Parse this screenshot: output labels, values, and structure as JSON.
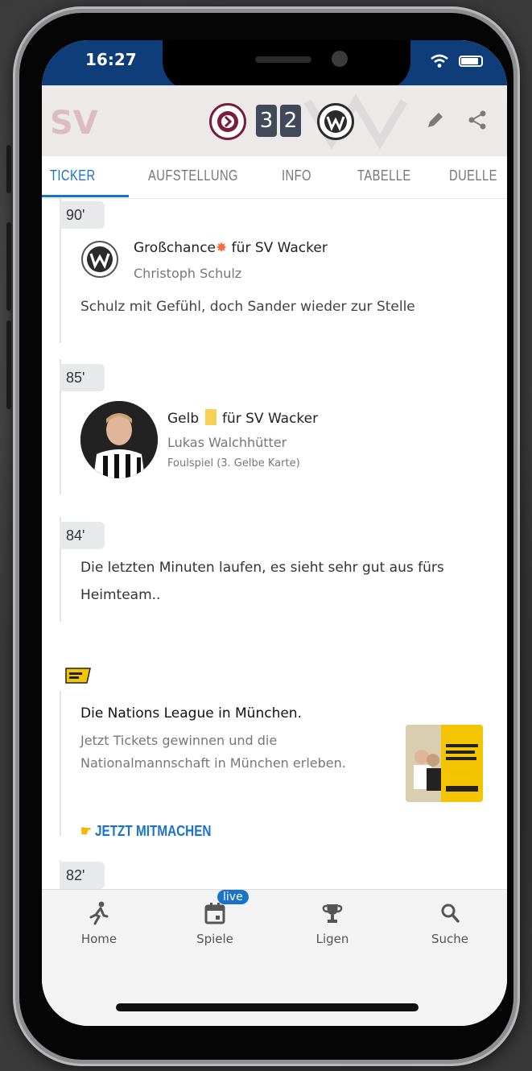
{
  "status": {
    "time": "16:27"
  },
  "match": {
    "home_score": "3",
    "away_score": "2"
  },
  "tabs": [
    "TICKER",
    "AUFSTELLUNG",
    "INFO",
    "TABELLE",
    "DUELLE"
  ],
  "ticker": [
    {
      "minute": "90'",
      "title_prefix": "Großchance",
      "title_suffix": " für SV Wacker",
      "player": "Christoph Schulz",
      "text": "Schulz mit Gefühl, doch Sander wieder zur Stelle"
    },
    {
      "minute": "85'",
      "title_prefix": "Gelb ",
      "title_suffix": " für SV Wacker",
      "player": "Lukas Walchhütter",
      "detail": "Foulspiel (3. Gelbe Karte)"
    },
    {
      "minute": "84'",
      "text_line1": "Die letzten Minuten laufen, es sieht sehr gut aus fürs",
      "text_line2": "Heimteam.."
    }
  ],
  "ad": {
    "title": "Die Nations League in München.",
    "line1": "Jetzt Tickets gewinnen und die",
    "line2": "Nationalmannschaft in München erleben.",
    "cta": "JETZT MITMACHEN"
  },
  "next_minute": "82'",
  "nav": {
    "home": "Home",
    "games": "Spiele",
    "live": "live",
    "leagues": "Ligen",
    "search": "Suche"
  },
  "colors": {
    "accent": "#1a73c9",
    "status_bar": "#0f3d7a",
    "yellow_card": "#f7d153"
  }
}
